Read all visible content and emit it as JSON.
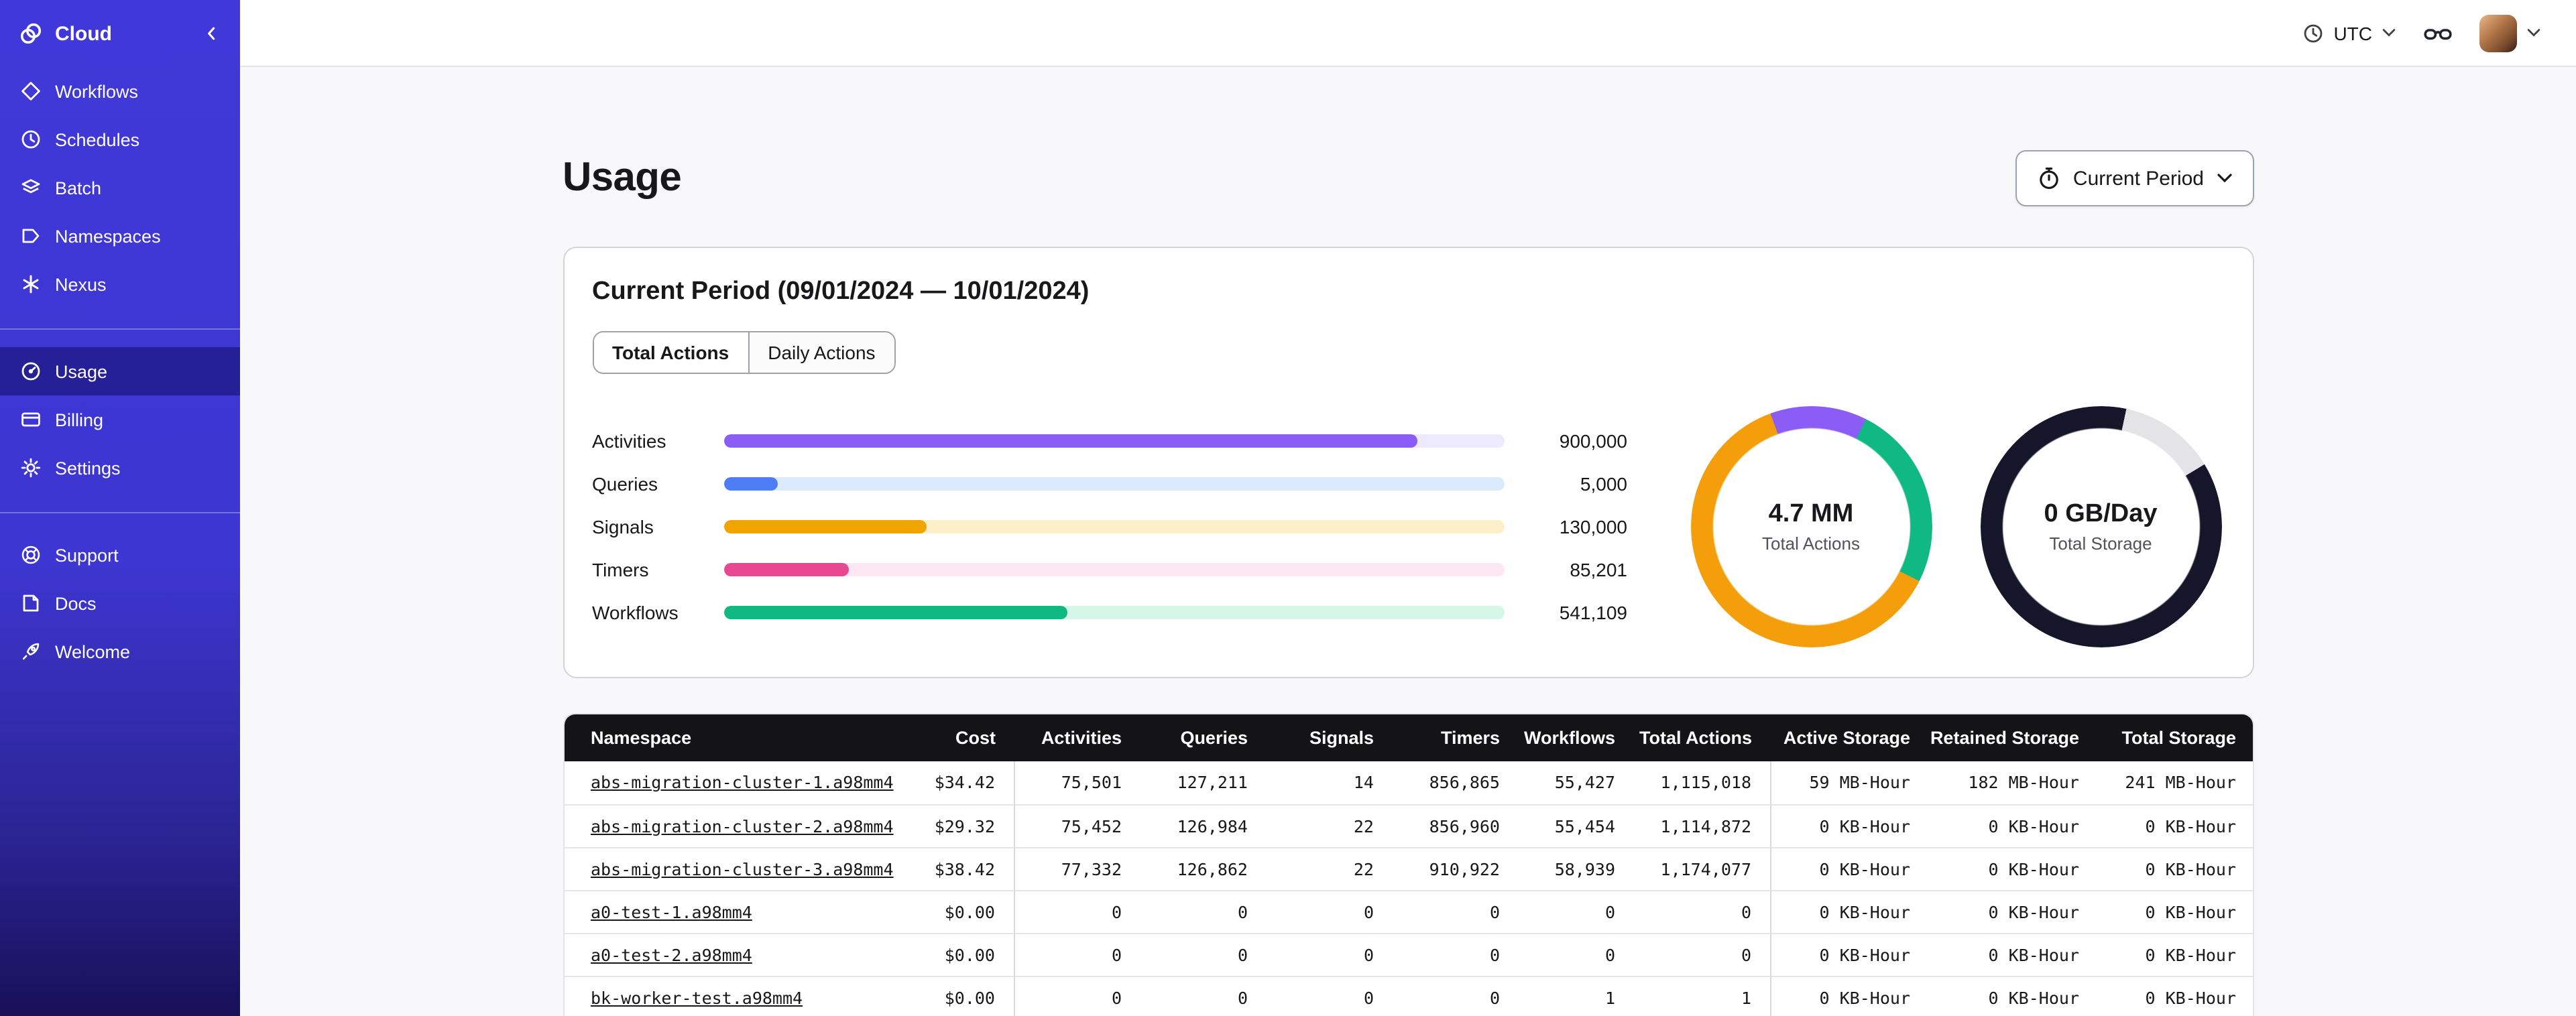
{
  "sidebar": {
    "logo_label": "Cloud",
    "nav_main": [
      {
        "label": "Workflows"
      },
      {
        "label": "Schedules"
      },
      {
        "label": "Batch"
      },
      {
        "label": "Namespaces"
      },
      {
        "label": "Nexus"
      }
    ],
    "nav_account": [
      {
        "label": "Usage",
        "active": true
      },
      {
        "label": "Billing",
        "active": false
      },
      {
        "label": "Settings",
        "active": false
      }
    ],
    "nav_footer": [
      {
        "label": "Support"
      },
      {
        "label": "Docs"
      },
      {
        "label": "Welcome"
      }
    ],
    "colors": {
      "background_top": "#4038d8",
      "background_bottom": "#181058"
    }
  },
  "topbar": {
    "timezone_label": "UTC",
    "icons": [
      "clock-icon",
      "chevron-down-icon",
      "glasses-icon",
      "user-avatar",
      "chevron-down-icon"
    ]
  },
  "page": {
    "title": "Usage",
    "period_button_label": "Current Period"
  },
  "usage_card": {
    "title": "Current Period (09/01/2024 — 10/01/2024)",
    "tabs": [
      {
        "label": "Total Actions",
        "active": true
      },
      {
        "label": "Daily Actions",
        "active": false
      }
    ]
  },
  "chart_data": [
    {
      "type": "bar",
      "orientation": "horizontal",
      "title": "Current period usage by action type",
      "categories": [
        "Activities",
        "Queries",
        "Signals",
        "Timers",
        "Workflows"
      ],
      "values": [
        900000,
        5000,
        130000,
        85201,
        541109
      ],
      "value_labels": [
        "900,000",
        "5,000",
        "130,000",
        "85,201",
        "541,109"
      ],
      "bar_colors": [
        "#8b5cf6",
        "#4f7df6",
        "#f0a400",
        "#e8488f",
        "#10b981"
      ],
      "track_colors": [
        "#ede9fe",
        "#dbeafe",
        "#fdf0c8",
        "#fce7f3",
        "#d4f7e7"
      ],
      "fill_pct": [
        89,
        7,
        26,
        16,
        44
      ],
      "grid": false,
      "legend": false
    },
    {
      "type": "donut",
      "center_value": "4.7 MM",
      "center_label": "Total Actions",
      "start_deg": -20,
      "segments": [
        {
          "name": "purple",
          "color": "#8b5cf6",
          "pct": 13
        },
        {
          "name": "green",
          "color": "#10b981",
          "pct": 25
        },
        {
          "name": "orange",
          "color": "#f59e0b",
          "pct": 62
        }
      ]
    },
    {
      "type": "donut",
      "center_value": "0 GB/Day",
      "center_label": "Total Storage",
      "start_deg": 12,
      "segments": [
        {
          "name": "gray",
          "color": "#e4e4e7",
          "pct": 13
        },
        {
          "name": "dark",
          "color": "#16162a",
          "pct": 87
        }
      ]
    }
  ],
  "table": {
    "columns": [
      "Namespace",
      "Cost",
      "Activities",
      "Queries",
      "Signals",
      "Timers",
      "Workflows",
      "Total Actions",
      "Active Storage",
      "Retained Storage",
      "Total Storage"
    ],
    "rows": [
      [
        "abs-migration-cluster-1.a98mm4",
        "$34.42",
        "75,501",
        "127,211",
        "14",
        "856,865",
        "55,427",
        "1,115,018",
        "59 MB-Hour",
        "182 MB-Hour",
        "241 MB-Hour"
      ],
      [
        "abs-migration-cluster-2.a98mm4",
        "$29.32",
        "75,452",
        "126,984",
        "22",
        "856,960",
        "55,454",
        "1,114,872",
        "0 KB-Hour",
        "0 KB-Hour",
        "0 KB-Hour"
      ],
      [
        "abs-migration-cluster-3.a98mm4",
        "$38.42",
        "77,332",
        "126,862",
        "22",
        "910,922",
        "58,939",
        "1,174,077",
        "0 KB-Hour",
        "0 KB-Hour",
        "0 KB-Hour"
      ],
      [
        "a0-test-1.a98mm4",
        "$0.00",
        "0",
        "0",
        "0",
        "0",
        "0",
        "0",
        "0 KB-Hour",
        "0 KB-Hour",
        "0 KB-Hour"
      ],
      [
        "a0-test-2.a98mm4",
        "$0.00",
        "0",
        "0",
        "0",
        "0",
        "0",
        "0",
        "0 KB-Hour",
        "0 KB-Hour",
        "0 KB-Hour"
      ],
      [
        "bk-worker-test.a98mm4",
        "$0.00",
        "0",
        "0",
        "0",
        "0",
        "1",
        "1",
        "0 KB-Hour",
        "0 KB-Hour",
        "0 KB-Hour"
      ]
    ]
  }
}
